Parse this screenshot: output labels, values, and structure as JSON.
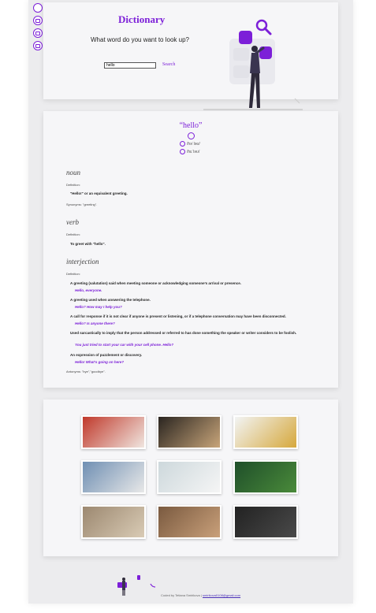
{
  "sidebar": {
    "buttons": [
      {
        "name": "sidebar-button-1"
      },
      {
        "name": "sidebar-button-2"
      },
      {
        "name": "sidebar-button-3"
      },
      {
        "name": "sidebar-button-4"
      }
    ]
  },
  "search": {
    "title": "Dictionary",
    "prompt": "What word do you want to look up?",
    "input_value": "hello",
    "button_label": "Search"
  },
  "result": {
    "word": "“hello”",
    "phonetics": [
      "/həˈləʊ/",
      "/hɛˈləʊ/"
    ],
    "meanings": [
      {
        "part_of_speech": "noun",
        "definition_label": "Definition:",
        "definitions": [
          {
            "text": "\"Hello!\" or an equivalent greeting.",
            "example": ""
          }
        ],
        "synonyms": "Synonyms: \"greeting\"."
      },
      {
        "part_of_speech": "verb",
        "definition_label": "Definition:",
        "definitions": [
          {
            "text": "To greet with \"hello\".",
            "example": ""
          }
        ],
        "synonyms": ""
      },
      {
        "part_of_speech": "interjection",
        "definition_label": "Definition:",
        "definitions": [
          {
            "text": "A greeting (salutation) said when meeting someone or acknowledging someone's arrival or presence.",
            "example": "Hello, everyone."
          },
          {
            "text": "A greeting used when answering the telephone.",
            "example": "Hello? How may I help you?"
          },
          {
            "text": "A call for response if it is not clear if anyone is present or listening, or if a telephone conversation may have been disconnected.",
            "example": "Hello? Is anyone there?"
          },
          {
            "text": "Used sarcastically to imply that the person addressed or referred to has done something the speaker or writer considers to be foolish.",
            "example": "You just tried to start your car with your cell phone. Hello?"
          },
          {
            "text": "An expression of puzzlement or discovery.",
            "example": "Hello! What's going on here?"
          }
        ],
        "synonyms": "Antonyms: \"bye\",\"goodbye\"."
      }
    ]
  },
  "photos": {
    "items": [
      {
        "name": "photo-1",
        "colors": [
          "#c0392b",
          "#f0e6e0"
        ]
      },
      {
        "name": "photo-2",
        "colors": [
          "#2a2520",
          "#c8a57a"
        ]
      },
      {
        "name": "photo-3",
        "colors": [
          "#f2f4f5",
          "#d6a83c"
        ]
      },
      {
        "name": "photo-4",
        "colors": [
          "#6f8fb3",
          "#e8e8e8"
        ]
      },
      {
        "name": "photo-5",
        "colors": [
          "#cdd8dc",
          "#f5f5f5"
        ]
      },
      {
        "name": "photo-6",
        "colors": [
          "#1f4f2a",
          "#4a8a3a"
        ]
      },
      {
        "name": "photo-7",
        "colors": [
          "#9c8870",
          "#d9cbb5"
        ]
      },
      {
        "name": "photo-8",
        "colors": [
          "#7a5a40",
          "#c9a07a"
        ]
      },
      {
        "name": "photo-9",
        "colors": [
          "#222222",
          "#4a4a4a"
        ]
      }
    ]
  },
  "footer": {
    "text": "Coded by Tetiana Smirikova |",
    "link": "smirikova0108@gmail.com"
  },
  "colors": {
    "accent": "#7c1fd8",
    "card": "#f6f6f8",
    "frame": "#ececee"
  }
}
